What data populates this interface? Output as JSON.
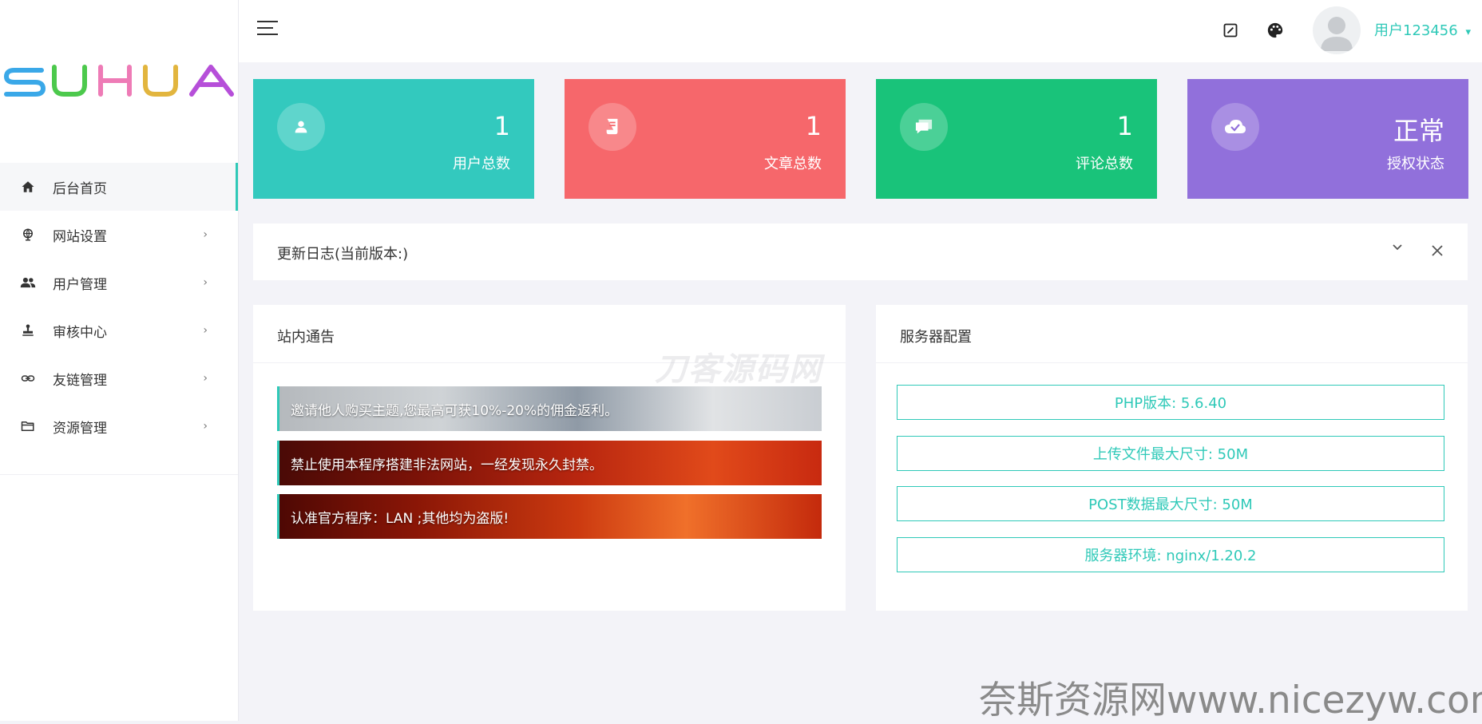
{
  "brand": {
    "logo_text": "SUHUA",
    "logo_colors": [
      "#3aa8e8",
      "#4cc94c",
      "#ee7bb6",
      "#e2b53e",
      "#b64fd9"
    ]
  },
  "sidebar": {
    "items": [
      {
        "label": "后台首页",
        "icon": "home-icon",
        "has_submenu": false,
        "active": true
      },
      {
        "label": "网站设置",
        "icon": "globe-icon",
        "has_submenu": true,
        "active": false
      },
      {
        "label": "用户管理",
        "icon": "users-icon",
        "has_submenu": true,
        "active": false
      },
      {
        "label": "审核中心",
        "icon": "stamp-icon",
        "has_submenu": true,
        "active": false
      },
      {
        "label": "友链管理",
        "icon": "link-icon",
        "has_submenu": true,
        "active": false
      },
      {
        "label": "资源管理",
        "icon": "folder-icon",
        "has_submenu": true,
        "active": false
      }
    ],
    "chevron": "›"
  },
  "topbar": {
    "menu_icon": "hamburger-icon",
    "tools": [
      "edit-icon",
      "palette-icon"
    ],
    "username": "用户123456",
    "user_caret": "▾"
  },
  "stats": [
    {
      "value": "1",
      "label": "用户总数",
      "color": "#33c9be",
      "icon": "user-icon"
    },
    {
      "value": "1",
      "label": "文章总数",
      "color": "#f6676b",
      "icon": "document-icon"
    },
    {
      "value": "1",
      "label": "评论总数",
      "color": "#19c37a",
      "icon": "comment-icon"
    },
    {
      "value": "正常",
      "label": "授权状态",
      "color": "#9170db",
      "icon": "cloud-check-icon"
    }
  ],
  "changelog": {
    "title": "更新日志(当前版本:)"
  },
  "announcements": {
    "title": "站内通告",
    "items": [
      "邀请他人购买主题,您最高可获10%-20%的佣金返利。",
      "禁止使用本程序搭建非法网站，一经发现永久封禁。",
      "认准官方程序：LAN ;其他均为盗版!"
    ]
  },
  "server": {
    "title": "服务器配置",
    "items": [
      "PHP版本: 5.6.40",
      "上传文件最大尺寸: 50M",
      "POST数据最大尺寸: 50M",
      "服务器环境: nginx/1.20.2"
    ]
  },
  "watermarks": {
    "center": "刀客源码网",
    "bottom_right": "奈斯资源网www.nicezyw.com"
  },
  "colors": {
    "accent": "#2fc9b8",
    "background": "#f3f3f8"
  }
}
